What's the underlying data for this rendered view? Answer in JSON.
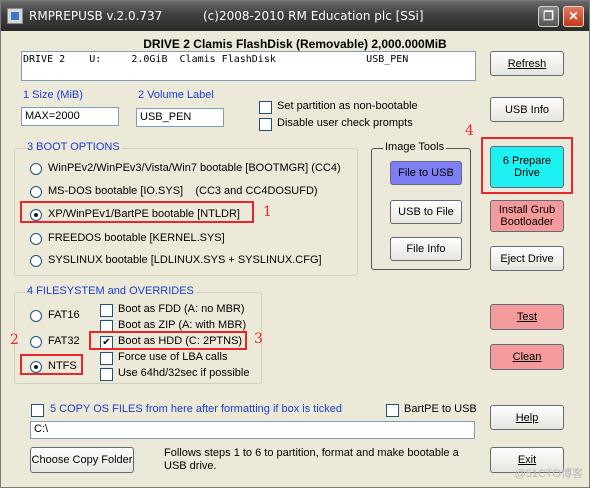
{
  "window": {
    "app_name": "RMPREPUSB v.2.0.737",
    "copyright": "(c)2008-2010 RM Education plc [SSi]",
    "controls": {
      "restore_glyph": "❐",
      "close_glyph": "✕"
    }
  },
  "drive": {
    "title": "DRIVE 2 Clamis FlashDisk  (Removable) 2,000.000MiB",
    "list_row": "DRIVE 2    U:     2.0GiB  Clamis FlashDisk               USB_PEN"
  },
  "size": {
    "label": "1 Size (MiB)",
    "value": "MAX=2000"
  },
  "volume": {
    "label": "2 Volume Label",
    "value": "USB_PEN"
  },
  "options": [
    {
      "label": "Set partition as non-bootable",
      "checked": false
    },
    {
      "label": "Disable user check prompts",
      "checked": false
    }
  ],
  "boot_options": {
    "title": "3 BOOT OPTIONS",
    "items": [
      {
        "label": "WinPEv2/WinPEv3/Vista/Win7 bootable [BOOTMGR] (CC4)",
        "selected": false
      },
      {
        "label": "MS-DOS bootable [IO.SYS]    (CC3 and CC4DOSUFD)",
        "selected": false
      },
      {
        "label": "XP/WinPEv1/BartPE bootable [NTLDR]",
        "selected": true
      },
      {
        "label": "FREEDOS bootable [KERNEL.SYS]",
        "selected": false
      },
      {
        "label": "SYSLINUX bootable [LDLINUX.SYS + SYSLINUX.CFG]",
        "selected": false
      }
    ]
  },
  "filesystem": {
    "title": "4 FILESYSTEM and OVERRIDES",
    "types": [
      {
        "label": "FAT16",
        "selected": false
      },
      {
        "label": "FAT32",
        "selected": false
      },
      {
        "label": "NTFS",
        "selected": true
      }
    ],
    "overrides": [
      {
        "label": "Boot as FDD (A: no MBR)",
        "checked": false
      },
      {
        "label": "Boot as ZIP (A: with MBR)",
        "checked": false
      },
      {
        "label": "Boot as HDD (C: 2PTNS)",
        "checked": true
      },
      {
        "label": "Force use of LBA calls",
        "checked": false
      },
      {
        "label": "Use 64hd/32sec if possible",
        "checked": false
      }
    ]
  },
  "image_tools": {
    "title": "Image Tools",
    "file_to_usb": "File to USB",
    "usb_to_file": "USB to File",
    "file_info": "File Info"
  },
  "buttons": {
    "refresh": "Refresh",
    "usb_info": "USB Info",
    "prepare_line1": "6  Prepare",
    "prepare_line2": "Drive",
    "install_grub_line1": "Install Grub",
    "install_grub_line2": "Bootloader",
    "eject": "Eject Drive",
    "test": "Test",
    "clean": "Clean",
    "help": "Help",
    "exit": "Exit",
    "choose_copy_folder": "Choose Copy Folder"
  },
  "copy_files": {
    "label": "5 COPY OS FILES from here after formatting if box is ticked",
    "checked": false
  },
  "bartpe": {
    "label": "BartPE to USB",
    "checked": false
  },
  "path": {
    "value": "C:\\"
  },
  "footer_hint": "Follows steps 1 to 6 to partition, format and make bootable a USB drive.",
  "annotations": {
    "n1": "1",
    "n2": "2",
    "n3": "3",
    "n4": "4",
    "color": "#e8262e"
  },
  "watermark": "@51CTO博客",
  "colors": {
    "prepare": "#1ef1f1",
    "file_to_usb": "#7f7ff5",
    "test_clean_grub": "#f49a9a",
    "section_title": "#1c3dcc"
  }
}
